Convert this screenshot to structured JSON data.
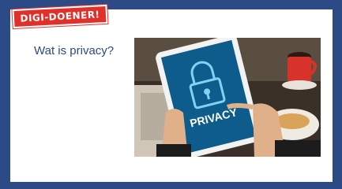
{
  "slide": {
    "logo_text": "DIGI-DOENER!",
    "question": "Wat is privacy?"
  },
  "image": {
    "tablet_text": "PRIVACY",
    "icon": "padlock-icon"
  },
  "colors": {
    "frame": "#2c4a86",
    "logo_bg": "#e0302a",
    "question_text": "#2c4a86",
    "screen": "#0e5c8c"
  }
}
